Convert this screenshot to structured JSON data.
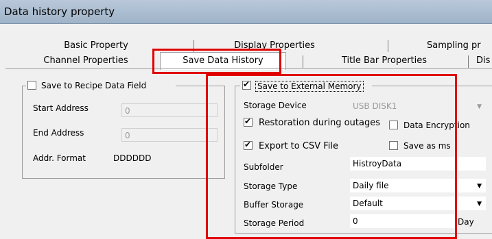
{
  "window": {
    "title": "Data history property"
  },
  "tabs": {
    "back_row": [
      "Basic Property",
      "Display Properties",
      "Sampling pr"
    ],
    "front_row": [
      "Channel Properties",
      "Save Data History",
      "Title Bar Properties",
      "Dis"
    ]
  },
  "recipe_group": {
    "checkbox_label": "Save to Recipe Data Field",
    "checked": false,
    "start_address_label": "Start Address",
    "start_address_value": "0",
    "end_address_label": "End Address",
    "end_address_value": "0",
    "addr_format_label": "Addr. Format",
    "addr_format_value": "DDDDDD"
  },
  "external_group": {
    "checkbox_label": "Save to External Memory",
    "checked": true,
    "storage_device_label": "Storage Device",
    "storage_device_value": "USB DISK1",
    "restoration_label": "Restoration during outages",
    "restoration_checked": true,
    "encryption_label": "Data Encryption",
    "encryption_checked": false,
    "export_csv_label": "Export to CSV File",
    "export_csv_checked": true,
    "save_ms_label": "Save as ms",
    "save_ms_checked": false,
    "subfolder_label": "Subfolder",
    "subfolder_value": "HistroyData",
    "storage_type_label": "Storage Type",
    "storage_type_value": "Daily file",
    "buffer_storage_label": "Buffer Storage",
    "buffer_storage_value": "Default",
    "storage_period_label": "Storage Period",
    "storage_period_value": "0",
    "storage_period_unit": "Day"
  },
  "colors": {
    "highlight": "#e00000"
  }
}
